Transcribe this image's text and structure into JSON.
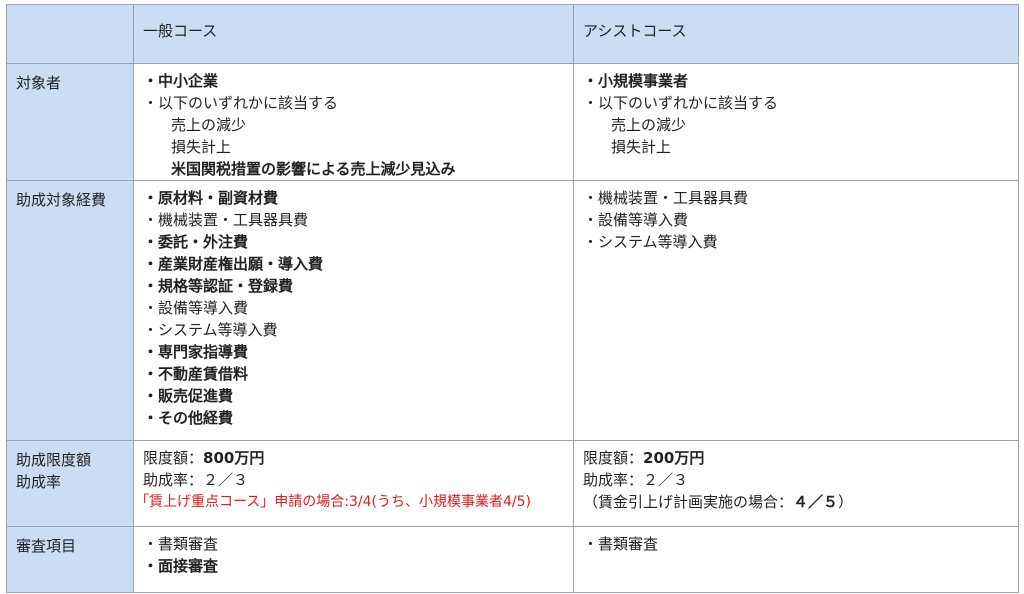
{
  "header": {
    "col1": "",
    "col2": "一般コース",
    "col3": "アシストコース"
  },
  "rows": [
    {
      "label": [
        "対象者"
      ],
      "general": [
        {
          "text": "・中小企業",
          "bold": true,
          "indent": false
        },
        {
          "text": "・以下のいずれかに該当する",
          "bold": false,
          "indent": false
        },
        {
          "text": "売上の減少",
          "bold": false,
          "indent": true
        },
        {
          "text": "損失計上",
          "bold": false,
          "indent": true
        },
        {
          "text": "米国関税措置の影響による売上減少見込み",
          "bold": true,
          "indent": true
        }
      ],
      "assist": [
        {
          "text": "・小規模事業者",
          "bold": true,
          "indent": false
        },
        {
          "text": "・以下のいずれかに該当する",
          "bold": false,
          "indent": false
        },
        {
          "text": "売上の減少",
          "bold": false,
          "indent": true
        },
        {
          "text": "損失計上",
          "bold": false,
          "indent": true
        }
      ]
    },
    {
      "label": [
        "助成対象経費"
      ],
      "general": [
        {
          "text": "・原材料・副資材費",
          "bold": true
        },
        {
          "text": "・機械装置・工具器具費",
          "bold": false
        },
        {
          "text": "・委託・外注費",
          "bold": true
        },
        {
          "text": "・産業財産権出願・導入費",
          "bold": true
        },
        {
          "text": "・規格等認証・登録費",
          "bold": true
        },
        {
          "text": "・設備等導入費",
          "bold": false
        },
        {
          "text": "・システム等導入費",
          "bold": false
        },
        {
          "text": "・専門家指導費",
          "bold": true
        },
        {
          "text": "・不動産賃借料",
          "bold": true
        },
        {
          "text": "・販売促進費",
          "bold": true
        },
        {
          "text": "・その他経費",
          "bold": true
        }
      ],
      "assist": [
        {
          "text": "・機械装置・工具器具費",
          "bold": false
        },
        {
          "text": "・設備等導入費",
          "bold": false
        },
        {
          "text": "・システム等導入費",
          "bold": false
        }
      ]
    },
    {
      "label": [
        "助成限度額",
        "助成率"
      ],
      "general_limit_label": "限度額：",
      "general_limit_value": "800万円",
      "general_rate": "助成率：２／３",
      "general_note": "「賃上げ重点コース」申請の場合:3/4(うち、小規模事業者4/5)",
      "assist_limit_label": "限度額：",
      "assist_limit_value": "200万円",
      "assist_rate": "助成率：２／３",
      "assist_note_prefix": "（賃金引上げ計画実施の場合：",
      "assist_note_value": "４／５",
      "assist_note_suffix": "）"
    },
    {
      "label": [
        "審査項目"
      ],
      "general": [
        {
          "text": "・書類審査",
          "bold": false
        },
        {
          "text": "・面接審査",
          "bold": true
        }
      ],
      "assist": [
        {
          "text": "・書類審査",
          "bold": false
        }
      ]
    }
  ]
}
